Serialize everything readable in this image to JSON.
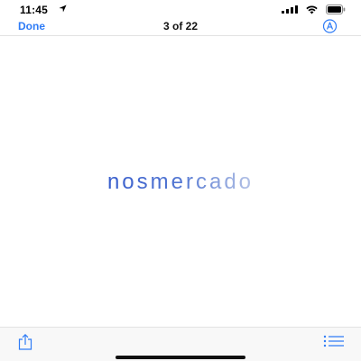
{
  "status_bar": {
    "time": "11:45",
    "icons": [
      "location-arrow-icon",
      "cellular-signal-icon",
      "wifi-icon",
      "battery-icon"
    ]
  },
  "nav_bar": {
    "done_label": "Done",
    "page_counter": "3 of 22",
    "markup_icon": "markup-pen-icon"
  },
  "document": {
    "logo_text": "nosmercado",
    "logo_colors": [
      "#3a5fcd",
      "#aebde3"
    ]
  },
  "toolbar": {
    "share_icon": "share-icon",
    "list_icon": "list-icon"
  },
  "colors": {
    "accent": "#2f7cf6"
  }
}
